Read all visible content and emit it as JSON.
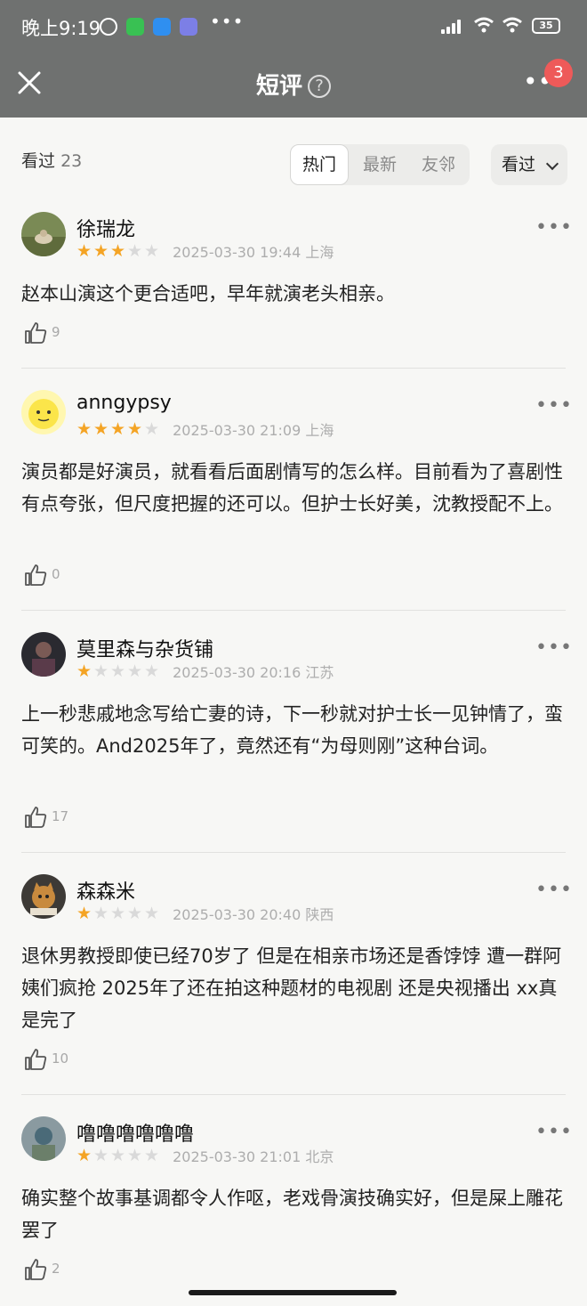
{
  "status_bar": {
    "time": "晚上9:19",
    "battery": "35"
  },
  "nav": {
    "title": "短评",
    "help": "?",
    "badge": "3"
  },
  "filter": {
    "count_label": "看过",
    "count_value": "23",
    "tabs": [
      "热门",
      "最新",
      "友邻"
    ],
    "active_tab": "热门",
    "dropdown_label": "看过"
  },
  "reviews": [
    {
      "user": "徐瑞龙",
      "rating": 3,
      "date": "2025-03-30 19:44",
      "location": "上海",
      "text": "赵本山演这个更合适吧，早年就演老头相亲。",
      "likes": "9"
    },
    {
      "user": "anngypsy",
      "rating": 4,
      "date": "2025-03-30 21:09",
      "location": "上海",
      "text": "演员都是好演员，就看看后面剧情写的怎么样。目前看为了喜剧性有点夸张，但尺度把握的还可以。但护士长好美，沈教授配不上。",
      "likes": "0"
    },
    {
      "user": "莫里森与杂货铺",
      "rating": 1,
      "date": "2025-03-30 20:16",
      "location": "江苏",
      "text": "上一秒悲戚地念写给亡妻的诗，下一秒就对护士长一见钟情了，蛮可笑的。And2025年了，竟然还有“为母则刚”这种台词。",
      "likes": "17"
    },
    {
      "user": "森森米",
      "rating": 1,
      "date": "2025-03-30 20:40",
      "location": "陕西",
      "text": "退休男教授即使已经70岁了 但是在相亲市场还是香饽饽 遭一群阿姨们疯抢 2025年了还在拍这种题材的电视剧 还是央视播出 xx真是完了",
      "likes": "10"
    },
    {
      "user": "噜噜噜噜噜噜",
      "rating": 1,
      "date": "2025-03-30 21:01",
      "location": "北京",
      "text": "确实整个故事基调都令人作呕，老戏骨演技确实好，但是屎上雕花罢了",
      "likes": "2"
    }
  ]
}
